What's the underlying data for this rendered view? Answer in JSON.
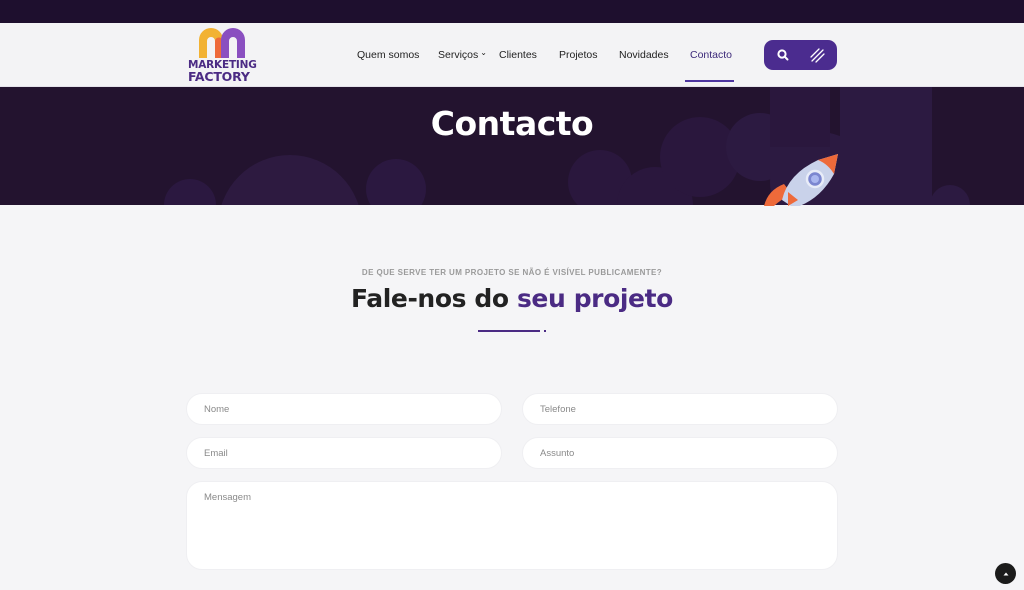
{
  "brand": {
    "logo_line1": "MARKETING",
    "logo_line2": "FACTORY",
    "colors": {
      "primary": "#4b2b84",
      "logo_yellow": "#f2b233",
      "logo_orange": "#ee6a3a",
      "logo_purple": "#5a3598",
      "hero_bg": "#23132f"
    }
  },
  "nav": {
    "items": [
      {
        "label": "Quem somos",
        "active": false
      },
      {
        "label": "Serviços",
        "active": false,
        "has_dropdown": true,
        "dropdown_icon": "chevron-down-icon"
      },
      {
        "label": "Clientes",
        "active": false
      },
      {
        "label": "Projetos",
        "active": false
      },
      {
        "label": "Novidades",
        "active": false
      },
      {
        "label": "Contacto",
        "active": true
      }
    ],
    "search_icon": "search-icon",
    "menu_icon": "hamburger-slash-icon"
  },
  "hero": {
    "title": "Contacto",
    "decoration_icon": "rocket-icon"
  },
  "section": {
    "eyebrow": "DE QUE SERVE TER UM PROJETO SE NÃO É VISÍVEL PUBLICAMENTE?",
    "heading_plain": "Fale-nos do ",
    "heading_accent": "seu projeto"
  },
  "form": {
    "nome_placeholder": "Nome",
    "telefone_placeholder": "Telefone",
    "email_placeholder": "Email",
    "assunto_placeholder": "Assunto",
    "mensagem_placeholder": "Mensagem"
  },
  "scroll_top_icon": "arrow-up-icon"
}
